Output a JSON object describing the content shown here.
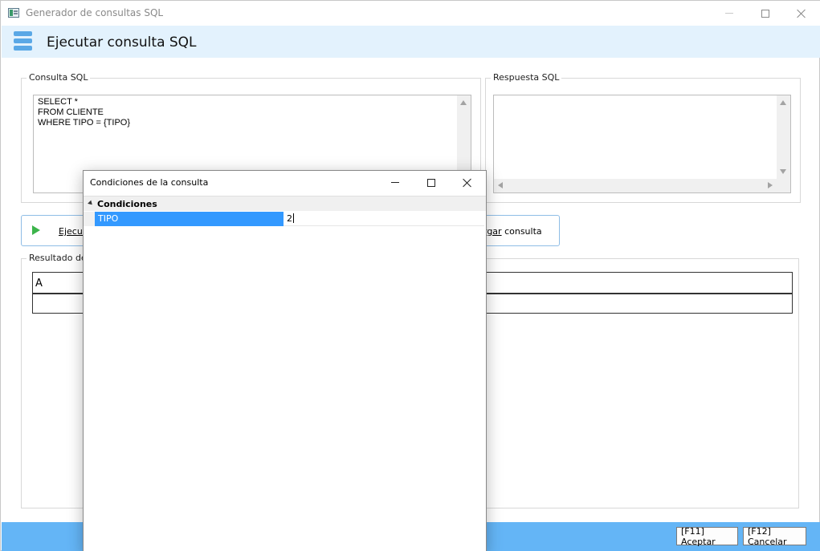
{
  "window": {
    "title": "Generador de consultas SQL"
  },
  "header": {
    "title": "Ejecutar consulta SQL"
  },
  "sql_group": {
    "label": "Consulta SQL",
    "query": "SELECT *\nFROM CLIENTE\nWHERE TIPO = {TIPO}"
  },
  "response_group": {
    "label": "Respuesta SQL",
    "value": ""
  },
  "actions": {
    "execute_label": "Ejecut",
    "load_prefix": "",
    "load_underlined": "rgar",
    "load_suffix": " consulta"
  },
  "result_group": {
    "label": "Resultado de",
    "columns": [
      "A"
    ]
  },
  "footer": {
    "accept_label": "[F11] Aceptar",
    "cancel_label": "[F12] Cancelar"
  },
  "dialog": {
    "title": "Condiciones de la consulta",
    "section": "Condiciones",
    "properties": [
      {
        "name": "TIPO",
        "value": "2"
      }
    ]
  },
  "colors": {
    "header_bg": "#e3f2fd",
    "accent": "#64b5f6",
    "selection": "#3399ff",
    "play_icon": "#3cb44b"
  }
}
